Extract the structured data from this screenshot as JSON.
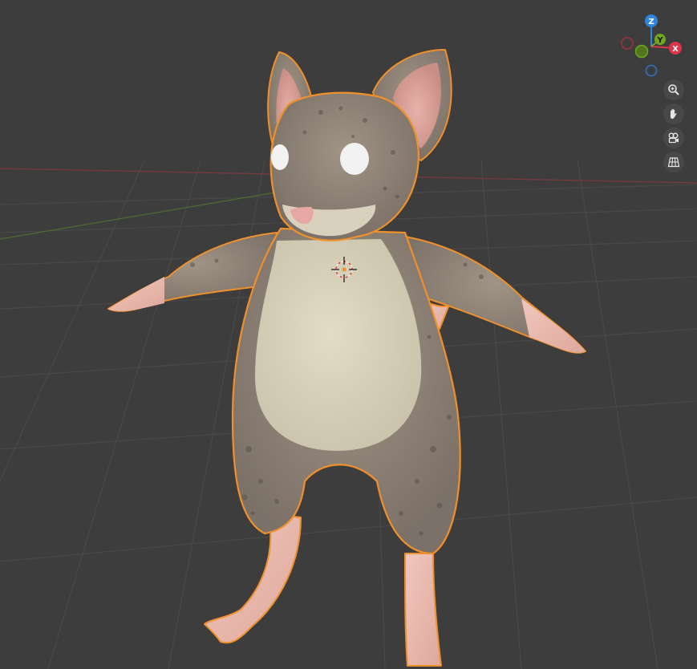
{
  "viewport": {
    "background": "#3d3d3d",
    "selection_outline_color": "#f0902a",
    "object": "mouse-character"
  },
  "navigation_gizmo": {
    "axes": [
      {
        "label": "Z",
        "color": "#2f85e0"
      },
      {
        "label": "Y",
        "color": "#6fa81f"
      },
      {
        "label": "X",
        "color": "#e0334a"
      }
    ]
  },
  "view_controls": [
    {
      "name": "zoom",
      "icon": "magnifier-plus-icon"
    },
    {
      "name": "pan",
      "icon": "hand-icon"
    },
    {
      "name": "camera",
      "icon": "camera-icon"
    },
    {
      "name": "perspective-toggle",
      "icon": "grid-icon"
    }
  ]
}
